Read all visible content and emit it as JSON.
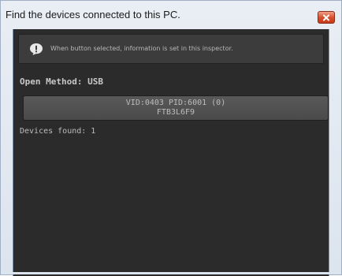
{
  "window": {
    "title": "Find the devices connected to this PC."
  },
  "helpbox": {
    "icon": "exclamation-icon",
    "message": "When button selected, information is set in this inspector."
  },
  "open_method": {
    "label": "Open Method: USB"
  },
  "devices": [
    {
      "line1": "VID:0403 PID:6001 (0)",
      "line2": "FTB3L6F9"
    }
  ],
  "devices_found": {
    "label": "Devices found: 1"
  },
  "colors": {
    "panel_bg": "#2b2b2b",
    "close_button": "#d8522e"
  }
}
